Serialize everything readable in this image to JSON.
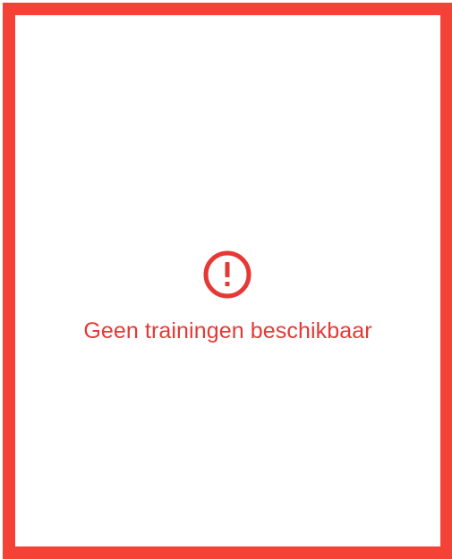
{
  "empty_state": {
    "icon": "alert-circle-icon",
    "message": "Geen trainingen beschikbaar"
  },
  "colors": {
    "border": "#f44336",
    "accent": "#e53935",
    "background": "#ffffff"
  }
}
